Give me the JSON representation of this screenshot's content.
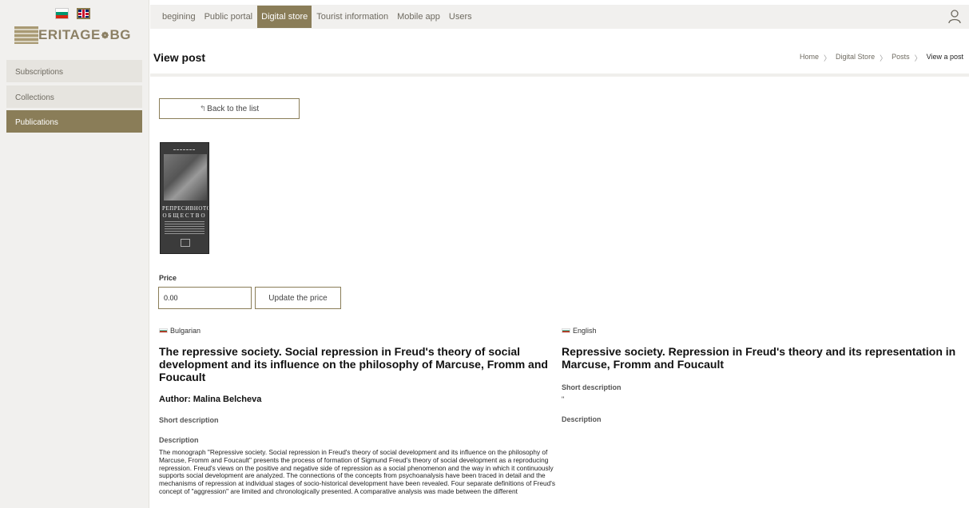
{
  "sidebar": {
    "logo_text": "ERITAGE",
    "logo_suffix": "BG",
    "items": [
      {
        "label": "Subscriptions"
      },
      {
        "label": "Collections"
      },
      {
        "label": "Publications"
      }
    ]
  },
  "topbar": {
    "tabs": [
      {
        "label": "begining"
      },
      {
        "label": "Public portal"
      },
      {
        "label": "Digital store"
      },
      {
        "label": "Tourist information"
      },
      {
        "label": "Mobile app"
      },
      {
        "label": "Users"
      }
    ],
    "active_tab": "Digital store"
  },
  "header": {
    "title": "View post",
    "breadcrumb": [
      "Home",
      "Digital Store",
      "Posts",
      "View a post"
    ]
  },
  "actions": {
    "back_label": "Back to the list",
    "price_label": "Price",
    "price_value": "0.00",
    "update_label": "Update the price"
  },
  "cover": {
    "title_line1": "РЕПРЕСИВНОТО",
    "title_line2": "ОБЩЕСТВО"
  },
  "bulgarian": {
    "language": "Bulgarian",
    "title": "The repressive society. Social repression in Freud's theory of social development and its influence on the philosophy of Marcuse, Fromm and Foucault",
    "author": "Author: Malina Belcheva",
    "short_description_label": "Short description",
    "description_label": "Description",
    "description": "The monograph \"Repressive society. Social repression in Freud's theory of social development and its influence on the philosophy of Marcuse, Fromm and Foucault\" presents the process of formation of Sigmund Freud's theory of social development as a reproducing repression. Freud's views on the positive and negative side of repression as a social phenomenon and the way in which it continuously supports social development are analyzed. The connections of the concepts from psychoanalysis have been traced in detail and the mechanisms of repression at individual stages of socio-historical development have been revealed. Four separate definitions of Freud's concept of \"aggression\" are limited and chronologically presented. A comparative analysis was made between the different"
  },
  "english": {
    "language": "English",
    "title": "Repressive society. Repression in Freud's theory and its representation in Marcuse, Fromm and Foucault",
    "short_description_label": "Short description",
    "short_description_value": "\"",
    "description_label": "Description"
  },
  "colors": {
    "accent": "#8a7d58",
    "sidebar_bg": "#f1f0ee",
    "text": "#222222"
  },
  "icons": {
    "user": "user-icon",
    "back": "undo-arrow-icon",
    "breadcrumb_sep": "chevron-right-icon"
  }
}
